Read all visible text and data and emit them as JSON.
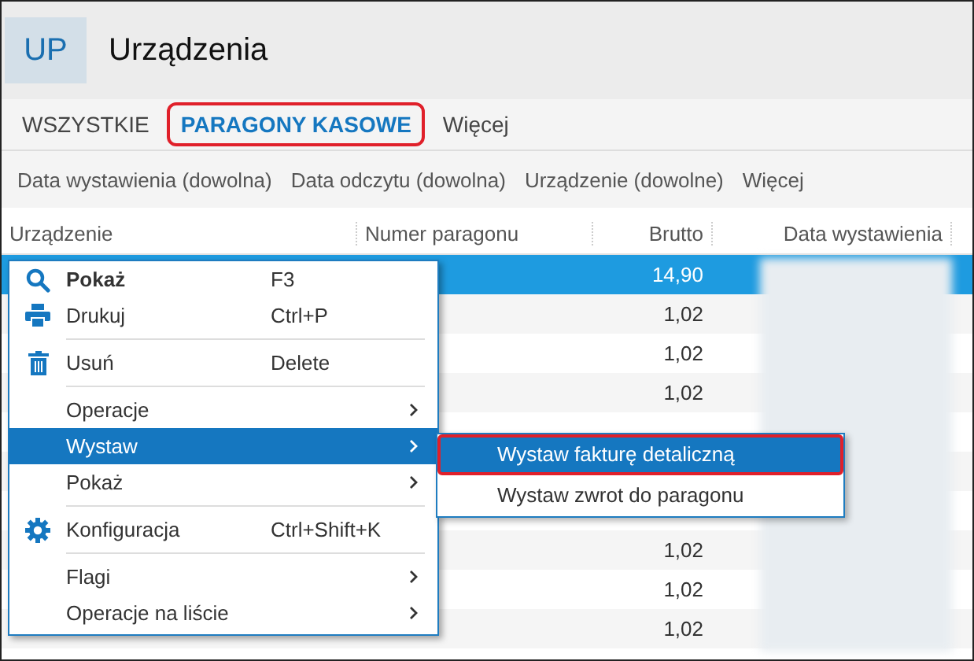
{
  "header": {
    "logo": "UP",
    "title": "Urządzenia"
  },
  "tabs": [
    {
      "label": "WSZYSTKIE",
      "selected": false,
      "marked": false
    },
    {
      "label": "PARAGONY KASOWE",
      "selected": true,
      "marked": true
    },
    {
      "label": "Więcej",
      "selected": false,
      "marked": false
    }
  ],
  "filters": [
    "Data wystawienia (dowolna)",
    "Data odczytu (dowolna)",
    "Urządzenie (dowolne)",
    "Więcej"
  ],
  "table": {
    "columns": [
      "Urządzenie",
      "Numer paragonu",
      "Brutto",
      "Data wystawienia"
    ],
    "rows": [
      {
        "brutto": "14,90",
        "selected": true
      },
      {
        "brutto": "1,02",
        "selected": false
      },
      {
        "brutto": "1,02",
        "selected": false
      },
      {
        "brutto": "1,02",
        "selected": false
      },
      {
        "selected": false
      },
      {
        "selected": false
      },
      {
        "selected": false
      },
      {
        "brutto": "1,02",
        "selected": false
      },
      {
        "brutto": "1,02",
        "selected": false
      },
      {
        "brutto": "1,02",
        "selected": false
      }
    ]
  },
  "context_menu": {
    "groups": [
      [
        {
          "kind": "search",
          "label": "Pokaż",
          "bold": true,
          "shortcut": "F3",
          "selected": false
        },
        {
          "kind": "print",
          "label": "Drukuj",
          "bold": false,
          "shortcut": "Ctrl+P",
          "selected": false
        }
      ],
      [
        {
          "kind": "trash",
          "label": "Usuń",
          "bold": false,
          "shortcut": "Delete",
          "selected": false
        }
      ],
      [
        {
          "kind": "submenu",
          "label": "Operacje",
          "bold": false,
          "selected": false
        },
        {
          "kind": "submenu",
          "label": "Wystaw",
          "bold": false,
          "selected": true
        },
        {
          "kind": "submenu",
          "label": "Pokaż",
          "bold": false,
          "selected": false
        }
      ],
      [
        {
          "kind": "gear",
          "label": "Konfiguracja",
          "bold": false,
          "shortcut": "Ctrl+Shift+K",
          "selected": false
        }
      ],
      [
        {
          "kind": "submenu",
          "label": "Flagi",
          "bold": false,
          "selected": false
        },
        {
          "kind": "submenu",
          "label": "Operacje na liście",
          "bold": false,
          "selected": false
        }
      ]
    ],
    "submenu": [
      {
        "label": "Wystaw fakturę detaliczną",
        "selected": true,
        "marked": true
      },
      {
        "label": "Wystaw zwrot do paragonu",
        "selected": false,
        "marked": false
      }
    ]
  }
}
